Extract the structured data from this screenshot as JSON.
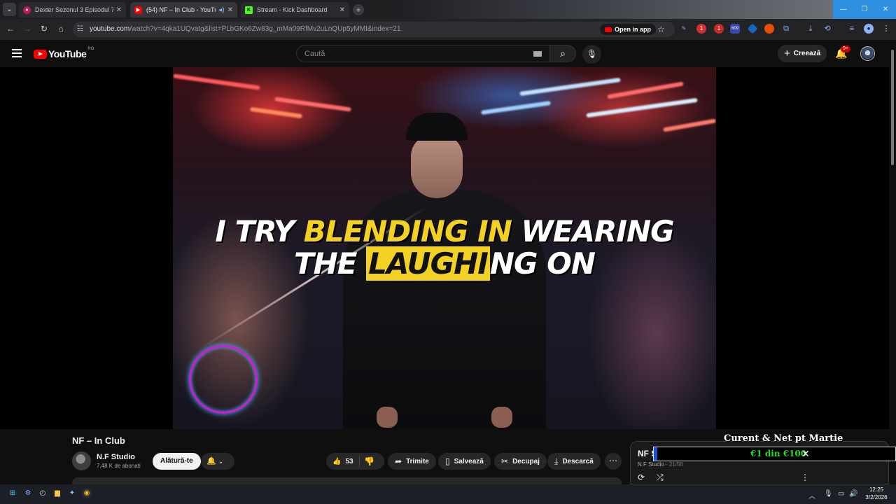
{
  "browser": {
    "tabs": [
      {
        "title": "Dexter Sezonul 3 Episodul 7 Online",
        "active": false
      },
      {
        "title": "(54) NF – In Club - YouTube",
        "active": true
      },
      {
        "title": "Stream - Kick Dashboard",
        "active": false
      }
    ],
    "url_host": "youtube.com",
    "url_path": "/watch?v=4qka1UQvatg&list=PLbGKo6Zw83g_mMa09RfMv2uLnQUp5yMMI&index=21",
    "open_in_app_label": "Open in app",
    "extension_badges": [
      "1",
      "1",
      "609"
    ]
  },
  "youtube": {
    "logo_text": "YouTube",
    "country_code": "RO",
    "search_placeholder": "Caută",
    "create_label": "Creează",
    "notification_badge": "9+"
  },
  "video": {
    "overlay_line1_a": "I TRY ",
    "overlay_line1_b": "BLENDING IN",
    "overlay_line1_c": " WEARING",
    "overlay_line2_a": "THE ",
    "overlay_line2_b": "LAUGHI",
    "overlay_line2_c": "NG ON",
    "title": "NF – In Club"
  },
  "channel": {
    "name": "N.F Studio",
    "subscribers": "7,48 K de abonați",
    "join_label": "Alătură-te"
  },
  "actions": {
    "likes": "53",
    "share_label": "Trimite",
    "save_label": "Salvează",
    "clip_label": "Decupaj",
    "download_label": "Descarcă"
  },
  "playlist": {
    "title": "NF Studio",
    "channel": "N.F Studio",
    "position": "21/56"
  },
  "stream_overlay": {
    "heading": "Curent & Net pt Martie",
    "amount": "€1 din €100",
    "progress": 0.01,
    "accent": "#2bd92b"
  },
  "taskbar": {
    "time": "12:25",
    "date": "3/2/2026"
  },
  "colors": {
    "youtube_red": "#ff0000",
    "highlight_yellow": "#f2d024",
    "windows_accent": "#2f8fe0"
  }
}
